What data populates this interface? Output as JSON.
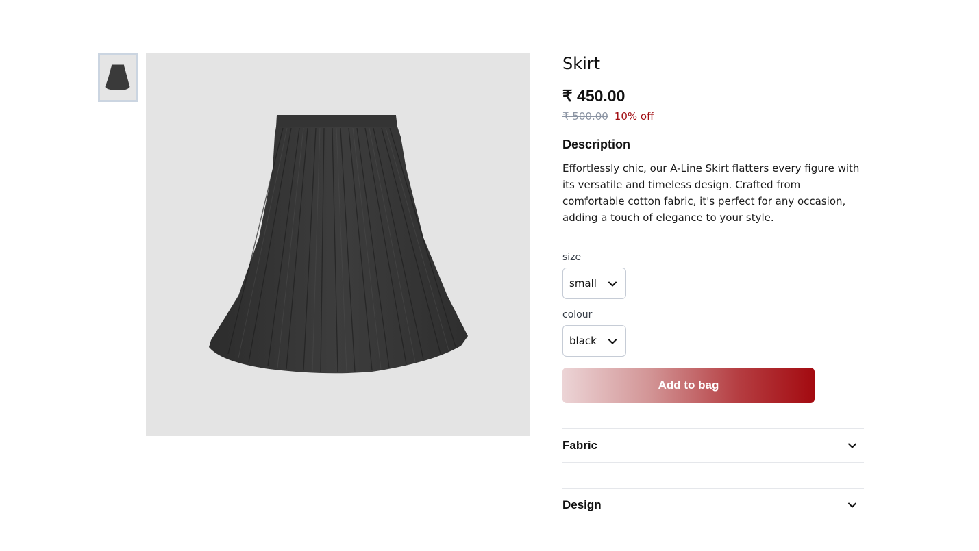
{
  "gallery": {
    "thumbnail_icon": "skirt-thumbnail",
    "main_image_icon": "black-pleated-skirt-image"
  },
  "product": {
    "title": "Skirt",
    "price": "₹ 450.00",
    "mrp": "₹ 500.00",
    "discount": "10% off",
    "description_heading": "Description",
    "description": "Effortlessly chic, our A-Line Skirt flatters every figure with its versatile and timeless design. Crafted from comfortable cotton fabric, it's perfect for any occasion, adding a touch of elegance to your style."
  },
  "options": {
    "size_label": "size",
    "size_value": "small",
    "colour_label": "colour",
    "colour_value": "black"
  },
  "actions": {
    "add_to_bag": "Add to bag"
  },
  "accordions": [
    {
      "label": "Fabric"
    },
    {
      "label": "Design"
    }
  ],
  "colors": {
    "discount": "#a10d12",
    "button_end": "#a30a10",
    "button_start": "#ecd4d6",
    "image_bg": "#e4e4e4"
  }
}
